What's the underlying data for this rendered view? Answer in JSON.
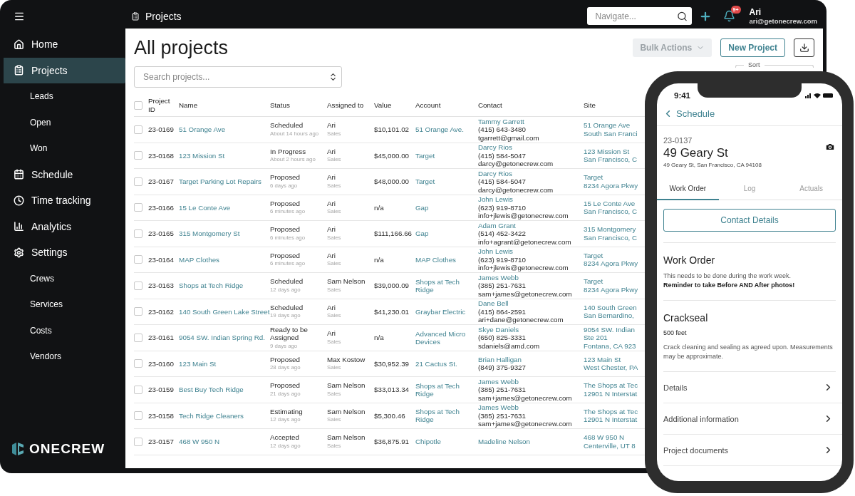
{
  "topbar": {
    "page_title": "Projects",
    "search": {
      "placeholder": "Navigate..."
    },
    "notifications_badge": "9+",
    "user": {
      "name": "Ari",
      "email": "ari@getonecrew.com"
    }
  },
  "sidebar": {
    "items": [
      {
        "label": "Home",
        "selected": false
      },
      {
        "label": "Projects",
        "selected": true,
        "children": [
          {
            "label": "Leads",
            "selected": false
          },
          {
            "label": "Open",
            "selected": false
          },
          {
            "label": "Won",
            "selected": false
          }
        ]
      },
      {
        "label": "Schedule",
        "selected": false
      },
      {
        "label": "Time tracking",
        "selected": false
      },
      {
        "label": "Analytics",
        "selected": false
      },
      {
        "label": "Settings",
        "selected": false,
        "children": [
          {
            "label": "Crews",
            "selected": false
          },
          {
            "label": "Services",
            "selected": false
          },
          {
            "label": "Costs",
            "selected": false
          },
          {
            "label": "Vendors",
            "selected": false
          }
        ]
      }
    ],
    "logo": "ONECREW"
  },
  "page": {
    "title": "All projects",
    "search": {
      "placeholder": "Search projects..."
    },
    "buttons": [
      {
        "label": "Bulk Actions",
        "kind": "menu",
        "disabled": true
      },
      {
        "label": "New Project",
        "kind": "outline",
        "disabled": false
      }
    ],
    "sort": {
      "label": "Sort"
    }
  },
  "table": {
    "all_checked": false,
    "columns": [
      "Project ID",
      "Name",
      "Status",
      "Assigned to",
      "Value",
      "Account",
      "Contact",
      "Site"
    ],
    "rows": [
      {
        "checked": false,
        "id": "23-0169",
        "name": "51 Orange Ave",
        "status": "Scheduled",
        "status_time": "About 14 hours ago",
        "assignee": "Ari",
        "role": "Sales",
        "value": "$10,101.02",
        "account": "51 Orange Ave.",
        "contact": {
          "name": "Tammy Garrett",
          "phone": "(415) 643-3480",
          "email": "tgarrett@gmail.com"
        },
        "site": [
          "51 Orange Ave",
          "South San Franci"
        ]
      },
      {
        "checked": false,
        "id": "23-0168",
        "name": "123 Mission St",
        "status": "In Progress",
        "status_time": "About 2 hours ago",
        "assignee": "Ari",
        "role": "Sales",
        "value": "$45,000.00",
        "account": "Target",
        "contact": {
          "name": "Darcy Rios",
          "phone": "(415) 584-5047",
          "email": "darcy@getonecrew.com"
        },
        "site": [
          "123 Mission St",
          "San Francisco, C"
        ]
      },
      {
        "checked": false,
        "id": "23-0167",
        "name": "Target Parking Lot Repairs",
        "status": "Proposed",
        "status_time": "6 days ago",
        "assignee": "Ari",
        "role": "Sales",
        "value": "$48,000.00",
        "account": "Target",
        "contact": {
          "name": "Darcy Rios",
          "phone": "(415) 584-5047",
          "email": "darcy@getonecrew.com"
        },
        "site": [
          "Target",
          "8234 Agora Pkwy"
        ]
      },
      {
        "checked": false,
        "id": "23-0166",
        "name": "15 Le Conte Ave",
        "status": "Proposed",
        "status_time": "6 minutes ago",
        "assignee": "Ari",
        "role": "Sales",
        "value": "n/a",
        "account": "Gap",
        "contact": {
          "name": "John Lewis",
          "phone": "(623) 919-8710",
          "email": "info+jlewis@getonecrew.com"
        },
        "site": [
          "15 Le Conte Ave",
          "San Francisco, C"
        ]
      },
      {
        "checked": false,
        "id": "23-0165",
        "name": "315 Montgomery St",
        "status": "Proposed",
        "status_time": "6 minutes ago",
        "assignee": "Ari",
        "role": "Sales",
        "value": "$111,166.66",
        "account": "Gap",
        "contact": {
          "name": "Adam Grant",
          "phone": "(514) 452-3422",
          "email": "info+agrant@getonecrew.com"
        },
        "site": [
          "315 Montgomery",
          "San Francisco, C"
        ]
      },
      {
        "checked": false,
        "id": "23-0164",
        "name": "MAP Clothes",
        "status": "Proposed",
        "status_time": "6 minutes ago",
        "assignee": "Ari",
        "role": "Sales",
        "value": "n/a",
        "account": "MAP Clothes",
        "contact": {
          "name": "John Lewis",
          "phone": "(623) 919-8710",
          "email": "info+jlewis@getonecrew.com"
        },
        "site": [
          "Target",
          "8234 Agora Pkwy"
        ]
      },
      {
        "checked": false,
        "id": "23-0163",
        "name": "Shops at Tech Ridge",
        "status": "Scheduled",
        "status_time": "12 days ago",
        "assignee": "Sam Nelson",
        "role": "Sales",
        "value": "$39,000.09",
        "account": "Shops at Tech Ridge",
        "contact": {
          "name": "James Webb",
          "phone": "(385) 251-7631",
          "email": "sam+james@getonecrew.com"
        },
        "site": [
          "Target",
          "8234 Agora Pkwy"
        ]
      },
      {
        "checked": false,
        "id": "23-0162",
        "name": "140 South Green Lake Street",
        "status": "Scheduled",
        "status_time": "19 days ago",
        "assignee": "Ari",
        "role": "Sales",
        "value": "$41,230.01",
        "account": "Graybar Electric",
        "contact": {
          "name": "Dane Bell",
          "phone": "(415) 864-2591",
          "email": "ari+dane@getonecrew.com"
        },
        "site": [
          "140 South Green",
          "San Bernardino,"
        ]
      },
      {
        "checked": false,
        "id": "23-0161",
        "name": "9054 SW. Indian Spring Rd.",
        "status": "Ready to be Assigned",
        "status_time": "9 days ago",
        "assignee": "Ari",
        "role": "Sales",
        "value": "n/a",
        "account": "Advanced Micro Devices",
        "contact": {
          "name": "Skye Daniels",
          "phone": "(650) 825-3331",
          "email": "sdaniels@amd.com"
        },
        "site": [
          "9054 SW. Indian",
          "Ste 201",
          "Fontana, CA 923"
        ]
      },
      {
        "checked": false,
        "id": "23-0160",
        "name": "123 Main St",
        "status": "Proposed",
        "status_time": "28 days ago",
        "assignee": "Max Kostow",
        "role": "Sales",
        "value": "$30,952.39",
        "account": "21 Cactus St.",
        "contact": {
          "name": "Brian Halligan",
          "phone": "(849) 375-9327"
        },
        "site": [
          "123 Main St",
          "West Chester, PA"
        ]
      },
      {
        "checked": false,
        "id": "23-0159",
        "name": "Best Buy Tech Ridge",
        "status": "Proposed",
        "status_time": "21 days ago",
        "assignee": "Sam Nelson",
        "role": "Sales",
        "value": "$33,013.34",
        "account": "Shops at Tech Ridge",
        "contact": {
          "name": "James Webb",
          "phone": "(385) 251-7631",
          "email": "sam+james@getonecrew.com"
        },
        "site": [
          "The Shops at Tec",
          "12901 N Interstat"
        ]
      },
      {
        "checked": false,
        "id": "23-0158",
        "name": "Tech Ridge Cleaners",
        "status": "Estimating",
        "status_time": "12 days ago",
        "assignee": "Sam Nelson",
        "role": "Sales",
        "value": "$5,300.46",
        "account": "Shops at Tech Ridge",
        "contact": {
          "name": "James Webb",
          "phone": "(385) 251-7631",
          "email": "sam+james@getonecrew.com"
        },
        "site": [
          "The Shops at Tec",
          "12901 N Interstat"
        ]
      },
      {
        "checked": false,
        "id": "23-0157",
        "name": "468 W 950 N",
        "status": "Accepted",
        "status_time": "12 days ago",
        "assignee": "Sam Nelson",
        "role": "Sales",
        "value": "$36,875.91",
        "account": "Chipotle",
        "contact": {
          "name": "Madeline Nelson"
        },
        "site": [
          "468 W 950 N",
          "Centerville, UT 8"
        ]
      }
    ]
  },
  "phone": {
    "time": "9:41",
    "back": "Schedule",
    "project_id": "23-0137",
    "title": "49 Geary St",
    "address": "49 Geary St, San Francisco, CA 94108",
    "tabs": [
      {
        "label": "Work Order",
        "selected": true
      },
      {
        "label": "Log",
        "selected": false
      },
      {
        "label": "Actuals",
        "selected": false
      }
    ],
    "contact_button": "Contact Details",
    "work_order": {
      "title": "Work Order",
      "note": "This needs to be done during the work week.",
      "reminder": "Reminder to take Before AND After photos!"
    },
    "service": {
      "title": "Crackseal",
      "quantity": "500 feet",
      "description": "Crack cleaning and sealing as agreed upon. Measurements may be approximate."
    },
    "links": [
      "Details",
      "Additional information",
      "Project documents"
    ]
  }
}
